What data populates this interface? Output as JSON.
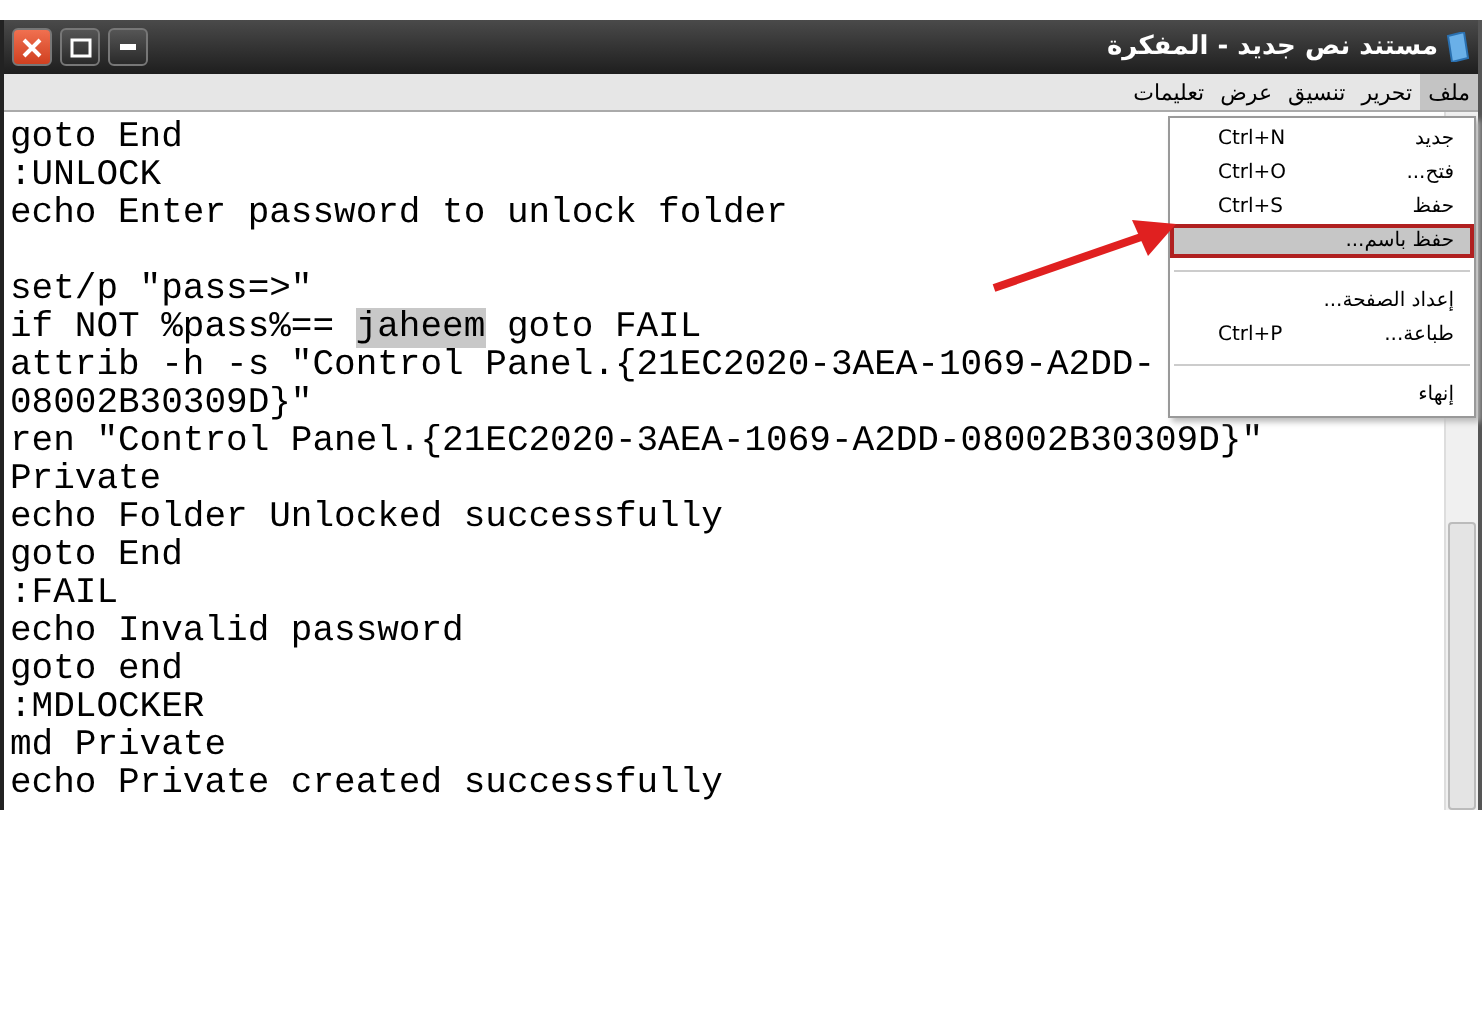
{
  "window": {
    "title": "مستند نص جديد - المفكرة"
  },
  "menu_bar": [
    {
      "label": "ملف",
      "selected": true
    },
    {
      "label": "تحرير",
      "selected": false
    },
    {
      "label": "تنسيق",
      "selected": false
    },
    {
      "label": "عرض",
      "selected": false
    },
    {
      "label": "تعليمات",
      "selected": false
    }
  ],
  "file_menu": [
    {
      "kind": "item",
      "label": "جديد",
      "shortcut": "Ctrl+N",
      "selected": false,
      "outlined": false
    },
    {
      "kind": "item",
      "label": "فتح...",
      "shortcut": "Ctrl+O",
      "selected": false,
      "outlined": false
    },
    {
      "kind": "item",
      "label": "حفظ",
      "shortcut": "Ctrl+S",
      "selected": false,
      "outlined": false
    },
    {
      "kind": "item",
      "label": "حفظ باسم...",
      "selected": true,
      "outlined": true
    },
    {
      "kind": "separator"
    },
    {
      "kind": "item",
      "label": "إعداد الصفحة...",
      "selected": false,
      "outlined": false
    },
    {
      "kind": "item",
      "label": "طباعة...",
      "shortcut": "Ctrl+P",
      "selected": false,
      "outlined": false
    },
    {
      "kind": "separator"
    },
    {
      "kind": "item",
      "label": "إنهاء",
      "selected": false,
      "outlined": false
    }
  ],
  "editor_lines": [
    {
      "kind": "text",
      "text": "goto End"
    },
    {
      "kind": "text",
      "text": ":UNLOCK"
    },
    {
      "kind": "text",
      "text": "echo Enter password to unlock folder"
    },
    {
      "kind": "blank"
    },
    {
      "kind": "text",
      "text": "set/p \"pass=>\""
    },
    {
      "kind": "with_selection",
      "before": "if NOT %pass%== ",
      "selection": "jaheem",
      "after": " goto FAIL"
    },
    {
      "kind": "text",
      "text": "attrib -h -s \"Control Panel.{21EC2020-3AEA-1069-A2DD-"
    },
    {
      "kind": "text",
      "text": "08002B30309D}\""
    },
    {
      "kind": "text",
      "text": "ren \"Control Panel.{21EC2020-3AEA-1069-A2DD-08002B30309D}\""
    },
    {
      "kind": "text",
      "text": "Private"
    },
    {
      "kind": "text",
      "text": "echo Folder Unlocked successfully"
    },
    {
      "kind": "text",
      "text": "goto End"
    },
    {
      "kind": "text",
      "text": ":FAIL"
    },
    {
      "kind": "text",
      "text": "echo Invalid password"
    },
    {
      "kind": "text",
      "text": "goto end"
    },
    {
      "kind": "text",
      "text": ":MDLOCKER"
    },
    {
      "kind": "text",
      "text": "md Private"
    },
    {
      "kind": "text",
      "text": "echo Private created successfully"
    }
  ]
}
